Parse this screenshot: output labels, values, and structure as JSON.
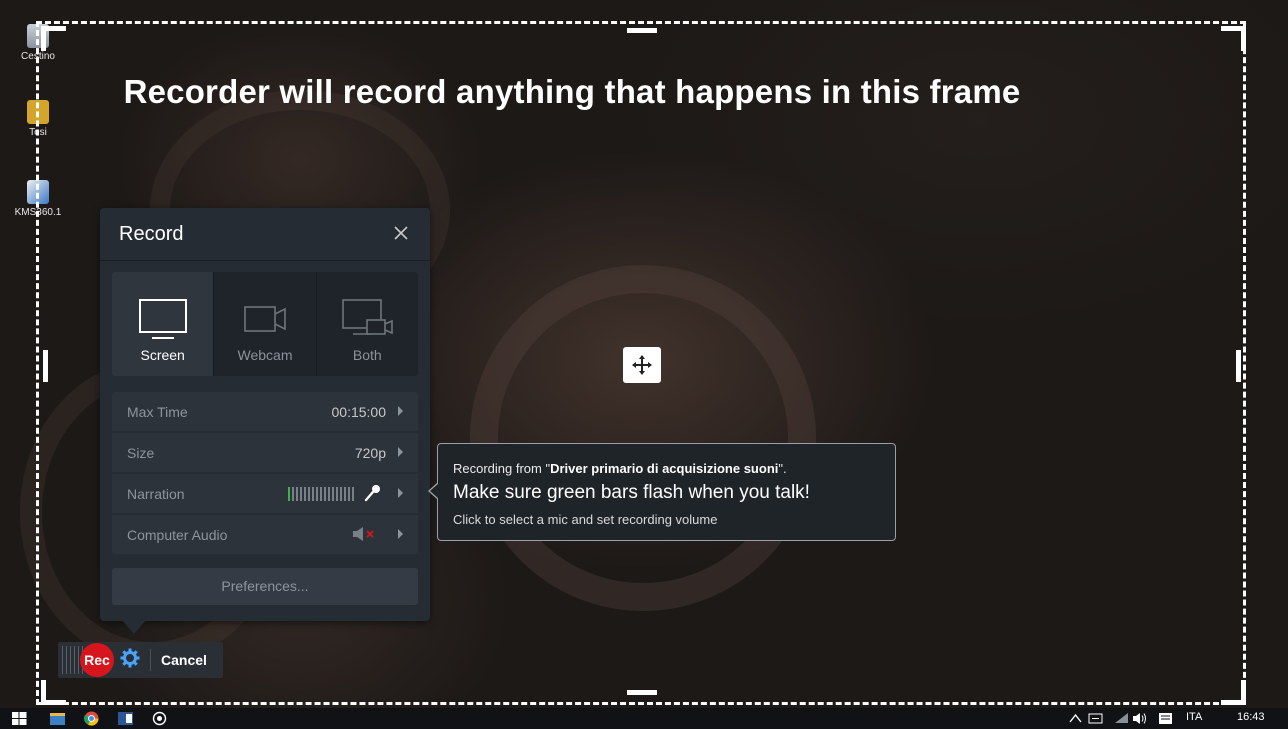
{
  "frame": {
    "title": "Recorder will record anything that happens in this frame"
  },
  "desktop": {
    "icons": [
      {
        "label": "Cestino",
        "icon": "recycle-bin-icon"
      },
      {
        "label": "Tesi",
        "icon": "folder-icon"
      },
      {
        "label": "KMS360.1",
        "icon": "program-icon"
      }
    ]
  },
  "record_panel": {
    "title": "Record",
    "modes": [
      {
        "label": "Screen",
        "icon": "monitor-icon",
        "active": true
      },
      {
        "label": "Webcam",
        "icon": "webcam-icon",
        "active": false
      },
      {
        "label": "Both",
        "icon": "monitor-webcam-icon",
        "active": false
      }
    ],
    "settings": [
      {
        "name": "Max Time",
        "value": "00:15:00"
      },
      {
        "name": "Size",
        "value": "720p"
      },
      {
        "name": "Narration",
        "value": "",
        "icon": "microphone-icon"
      },
      {
        "name": "Computer Audio",
        "value": "",
        "icon": "speaker-muted-icon"
      }
    ],
    "preferences_label": "Preferences..."
  },
  "tooltip": {
    "line1_prefix": "Recording from \"",
    "line1_device": "Driver primario di acquisizione suoni",
    "line1_suffix": "\".",
    "line2": "Make sure green bars flash when you talk!",
    "line3": "Click to select a mic and set recording volume"
  },
  "rec_bar": {
    "rec_label": "Rec",
    "cancel_label": "Cancel"
  },
  "taskbar": {
    "language": "ITA",
    "time": "16:43"
  },
  "colors": {
    "rec_red": "#d6161c",
    "panel_bg": "#262c33",
    "level_green": "#3bb54a"
  }
}
